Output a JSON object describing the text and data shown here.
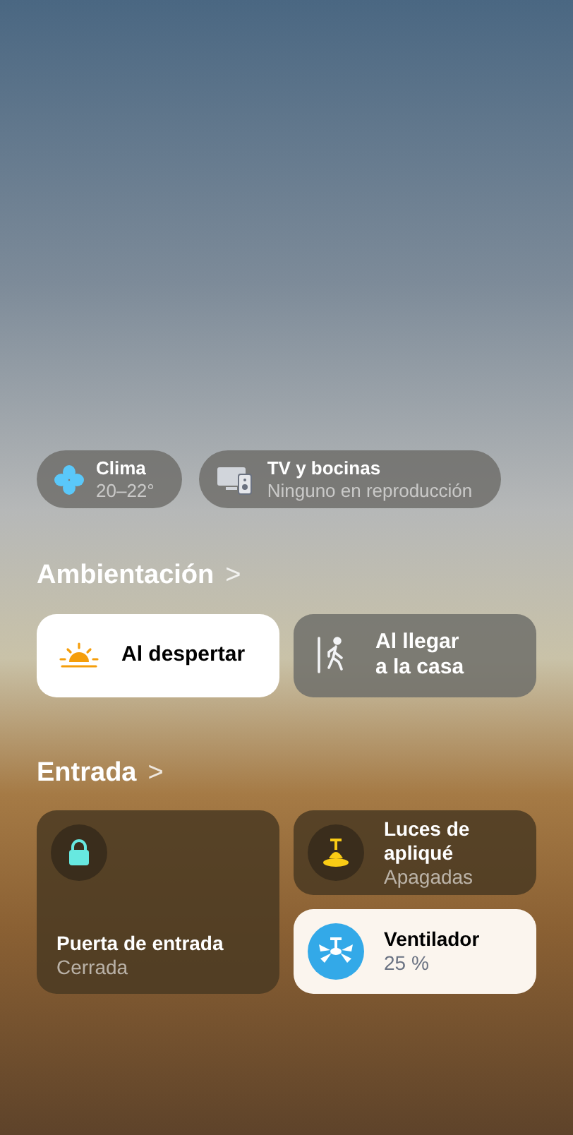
{
  "status": [
    {
      "kind": "climate",
      "title": "Clima",
      "subtitle": "20–22°"
    },
    {
      "kind": "media",
      "title": "TV y bocinas",
      "subtitle": "Ninguno en reproducción"
    }
  ],
  "scenes_header": {
    "title": "Ambientación",
    "chevron": ">"
  },
  "scenes": [
    {
      "kind": "sunrise",
      "label": "Al despertar",
      "on": true
    },
    {
      "kind": "arrive",
      "label": "Al llegar\na la casa",
      "on": false
    }
  ],
  "accessories_header": {
    "title": "Entrada",
    "chevron": ">"
  },
  "accessories": [
    {
      "kind": "lock",
      "name": "Puerta de entrada",
      "status": "Cerrada",
      "on": false,
      "tall": true
    },
    {
      "kind": "light",
      "name": "Luces de apliqué",
      "status": "Apagadas",
      "on": false,
      "tall": false
    },
    {
      "kind": "fan",
      "name": "Ventilador",
      "status": "25 %",
      "on": true,
      "tall": false
    }
  ]
}
